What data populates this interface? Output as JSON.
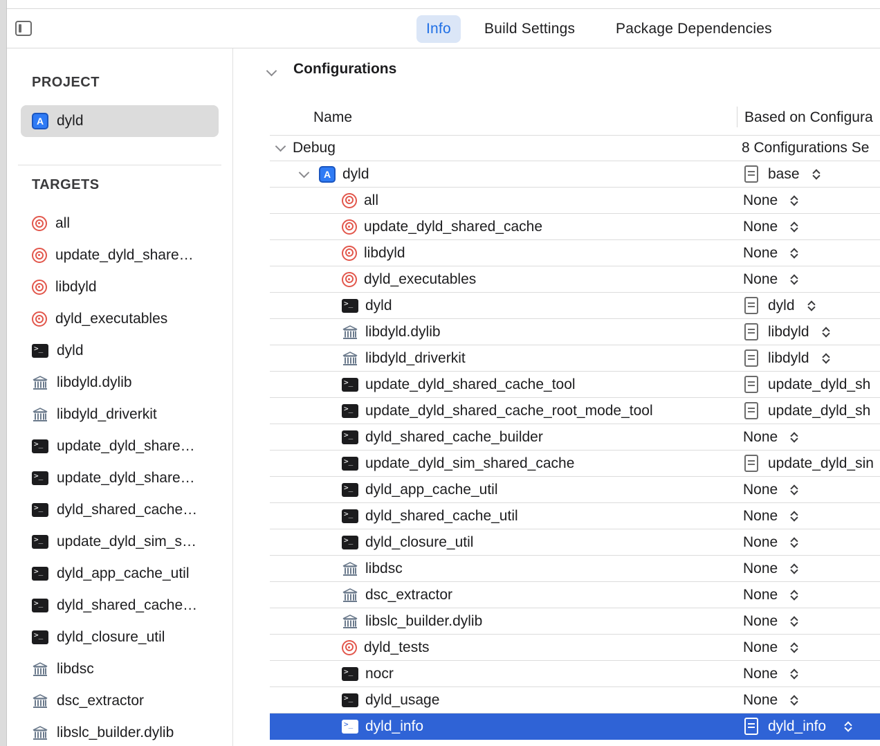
{
  "toolbar": {
    "tabs": [
      "Info",
      "Build Settings",
      "Package Dependencies"
    ],
    "active_tab": "Info"
  },
  "sidebar": {
    "project_title": "PROJECT",
    "project": {
      "label": "dyld",
      "icon": "app-project-icon"
    },
    "targets_title": "TARGETS",
    "targets": [
      {
        "label": "all",
        "icon": "target-icon"
      },
      {
        "label": "update_dyld_share…",
        "icon": "target-icon"
      },
      {
        "label": "libdyld",
        "icon": "target-icon"
      },
      {
        "label": "dyld_executables",
        "icon": "target-icon"
      },
      {
        "label": "dyld",
        "icon": "terminal-icon"
      },
      {
        "label": "libdyld.dylib",
        "icon": "library-icon"
      },
      {
        "label": "libdyld_driverkit",
        "icon": "library-icon"
      },
      {
        "label": "update_dyld_share…",
        "icon": "terminal-icon"
      },
      {
        "label": "update_dyld_share…",
        "icon": "terminal-icon"
      },
      {
        "label": "dyld_shared_cache…",
        "icon": "terminal-icon"
      },
      {
        "label": "update_dyld_sim_s…",
        "icon": "terminal-icon"
      },
      {
        "label": "dyld_app_cache_util",
        "icon": "terminal-icon"
      },
      {
        "label": "dyld_shared_cache…",
        "icon": "terminal-icon"
      },
      {
        "label": "dyld_closure_util",
        "icon": "terminal-icon"
      },
      {
        "label": "libdsc",
        "icon": "library-icon"
      },
      {
        "label": "dsc_extractor",
        "icon": "library-icon"
      },
      {
        "label": "libslc_builder.dylib",
        "icon": "library-icon"
      }
    ]
  },
  "main": {
    "section_title": "Configurations",
    "columns": {
      "name": "Name",
      "based_on": "Based on Configura"
    },
    "debug_row": {
      "label": "Debug",
      "summary": "8 Configurations Se"
    },
    "project_row": {
      "label": "dyld",
      "config": "base"
    },
    "rows": [
      {
        "label": "all",
        "icon": "target-icon",
        "config": "None",
        "has_file": false
      },
      {
        "label": "update_dyld_shared_cache",
        "icon": "target-icon",
        "config": "None",
        "has_file": false
      },
      {
        "label": "libdyld",
        "icon": "target-icon",
        "config": "None",
        "has_file": false
      },
      {
        "label": "dyld_executables",
        "icon": "target-icon",
        "config": "None",
        "has_file": false
      },
      {
        "label": "dyld",
        "icon": "terminal-icon",
        "config": "dyld",
        "has_file": true
      },
      {
        "label": "libdyld.dylib",
        "icon": "library-icon",
        "config": "libdyld",
        "has_file": true
      },
      {
        "label": "libdyld_driverkit",
        "icon": "library-icon",
        "config": "libdyld",
        "has_file": true
      },
      {
        "label": "update_dyld_shared_cache_tool",
        "icon": "terminal-icon",
        "config": "update_dyld_sh",
        "has_file": true
      },
      {
        "label": "update_dyld_shared_cache_root_mode_tool",
        "icon": "terminal-icon",
        "config": "update_dyld_sh",
        "has_file": true
      },
      {
        "label": "dyld_shared_cache_builder",
        "icon": "terminal-icon",
        "config": "None",
        "has_file": false
      },
      {
        "label": "update_dyld_sim_shared_cache",
        "icon": "terminal-icon",
        "config": "update_dyld_sin",
        "has_file": true
      },
      {
        "label": "dyld_app_cache_util",
        "icon": "terminal-icon",
        "config": "None",
        "has_file": false
      },
      {
        "label": "dyld_shared_cache_util",
        "icon": "terminal-icon",
        "config": "None",
        "has_file": false
      },
      {
        "label": "dyld_closure_util",
        "icon": "terminal-icon",
        "config": "None",
        "has_file": false
      },
      {
        "label": "libdsc",
        "icon": "library-icon",
        "config": "None",
        "has_file": false
      },
      {
        "label": "dsc_extractor",
        "icon": "library-icon",
        "config": "None",
        "has_file": false
      },
      {
        "label": "libslc_builder.dylib",
        "icon": "library-icon",
        "config": "None",
        "has_file": false
      },
      {
        "label": "dyld_tests",
        "icon": "target-icon",
        "config": "None",
        "has_file": false
      },
      {
        "label": "nocr",
        "icon": "terminal-icon",
        "config": "None",
        "has_file": false
      },
      {
        "label": "dyld_usage",
        "icon": "terminal-icon",
        "config": "None",
        "has_file": false
      },
      {
        "label": "dyld_info",
        "icon": "terminal-icon",
        "config": "dyld_info",
        "has_file": true,
        "selected": true
      }
    ]
  },
  "colors": {
    "accent": "#1f6fe5",
    "selection": "#2f63d6",
    "target": "#e2574c"
  }
}
